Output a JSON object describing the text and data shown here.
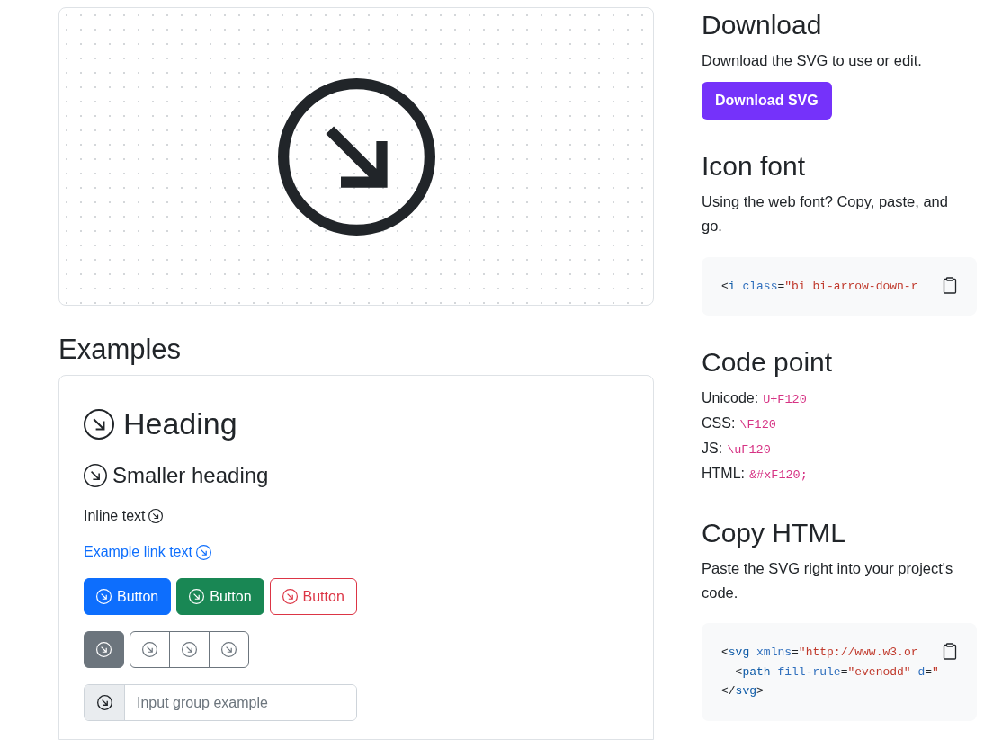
{
  "examples": {
    "title": "Examples",
    "heading": "Heading",
    "smaller_heading": "Smaller heading",
    "inline_text": "Inline text",
    "link_text": "Example link text",
    "buttons": [
      {
        "label": "Button",
        "kind": "primary"
      },
      {
        "label": "Button",
        "kind": "success"
      },
      {
        "label": "Button",
        "kind": "outline-danger"
      }
    ],
    "icon_buttons": [
      {
        "kind": "filled"
      },
      {
        "kind": "outline"
      },
      {
        "kind": "outline"
      },
      {
        "kind": "outline"
      }
    ],
    "input_group": {
      "placeholder": "Input group example"
    }
  },
  "download": {
    "title": "Download",
    "text": "Download the SVG to use or edit.",
    "button": "Download SVG"
  },
  "icon_font": {
    "title": "Icon font",
    "text": "Using the web font? Copy, paste, and go.",
    "code": [
      [
        {
          "kind": "punct",
          "text": "<"
        },
        {
          "kind": "tag",
          "text": "i "
        },
        {
          "kind": "attr",
          "text": "class"
        },
        {
          "kind": "punct",
          "text": "="
        },
        {
          "kind": "string",
          "text": "\"bi bi-arrow-down-r"
        }
      ]
    ]
  },
  "code_point": {
    "title": "Code point",
    "rows": [
      {
        "label": "Unicode:",
        "value": "U+F120"
      },
      {
        "label": "CSS:",
        "value": "\\F120"
      },
      {
        "label": "JS:",
        "value": "\\uF120"
      },
      {
        "label": "HTML:",
        "value": "&#xF120;"
      }
    ]
  },
  "copy_html": {
    "title": "Copy HTML",
    "text": "Paste the SVG right into your project's code.",
    "code": [
      [
        {
          "kind": "punct",
          "text": "<"
        },
        {
          "kind": "tag",
          "text": "svg "
        },
        {
          "kind": "attr",
          "text": "xmlns"
        },
        {
          "kind": "punct",
          "text": "="
        },
        {
          "kind": "string",
          "text": "\"http://www.w3.or"
        }
      ],
      [
        {
          "kind": "punct",
          "text": "  <"
        },
        {
          "kind": "tag",
          "text": "path "
        },
        {
          "kind": "attr",
          "text": "fill-rule"
        },
        {
          "kind": "punct",
          "text": "="
        },
        {
          "kind": "string",
          "text": "\"evenodd\""
        },
        {
          "kind": "attr",
          "text": " d"
        },
        {
          "kind": "punct",
          "text": "="
        },
        {
          "kind": "string",
          "text": "\""
        }
      ],
      [
        {
          "kind": "punct",
          "text": "</"
        },
        {
          "kind": "tag",
          "text": "svg"
        },
        {
          "kind": "punct",
          "text": ">"
        }
      ]
    ]
  }
}
